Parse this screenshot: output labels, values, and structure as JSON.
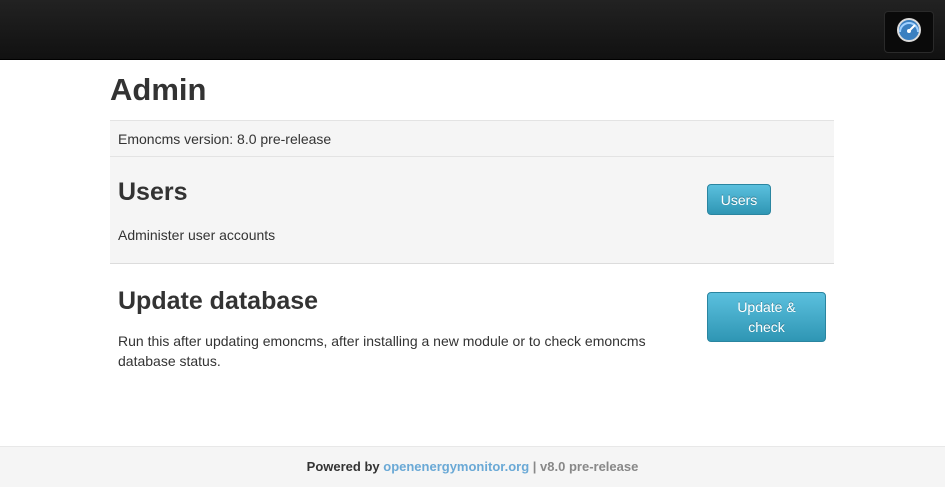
{
  "page": {
    "title": "Admin"
  },
  "version": {
    "text": "Emoncms version: 8.0 pre-release"
  },
  "users": {
    "heading": "Users",
    "description": "Administer user accounts",
    "button_label": "Users"
  },
  "update_db": {
    "heading": "Update database",
    "description_line1": "Run this after updating emoncms, after installing a new module or to check emoncms",
    "description_line2": "database status.",
    "button_line1": "Update &",
    "button_line2": "check"
  },
  "footer": {
    "powered_by": "Powered by",
    "link_text": "openenergymonitor.org",
    "separator": "|",
    "version": "v8.0 pre-release"
  },
  "colors": {
    "navbar": "#1b1b1b",
    "button_info": "#49afcd",
    "link": "#6aa9d6"
  },
  "icons": {
    "nav_logo": "speedometer-icon"
  }
}
